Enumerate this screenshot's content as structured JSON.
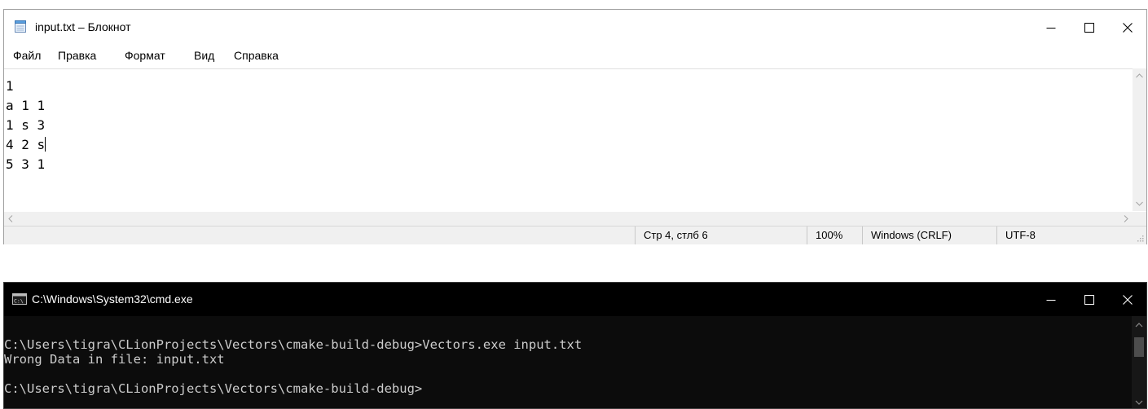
{
  "notepad": {
    "title": "input.txt – Блокнот",
    "menu": [
      "Файл",
      "Правка",
      "Формат",
      "Вид",
      "Справка"
    ],
    "lines": [
      "1",
      "a 1 1",
      "1 s 3",
      "4 2 s",
      "5 3 1"
    ],
    "status": {
      "position": "Стр 4, стлб 6",
      "zoom": "100%",
      "line_ending": "Windows (CRLF)",
      "encoding": "UTF-8"
    },
    "icons": [
      "notepad-icon",
      "minimize-icon",
      "maximize-icon",
      "close-icon"
    ]
  },
  "cmd": {
    "title": "C:\\Windows\\System32\\cmd.exe",
    "lines": [
      "C:\\Users\\tigra\\CLionProjects\\Vectors\\cmake-build-debug>Vectors.exe input.txt",
      "Wrong Data in file: input.txt",
      "",
      "C:\\Users\\tigra\\CLionProjects\\Vectors\\cmake-build-debug>"
    ],
    "icons": [
      "cmd-icon",
      "minimize-icon",
      "maximize-icon",
      "close-icon"
    ]
  },
  "colors": {
    "cmd_background": "#0c0c0c",
    "cmd_text": "#cccccc",
    "statusbar_background": "#f0f0f0"
  }
}
